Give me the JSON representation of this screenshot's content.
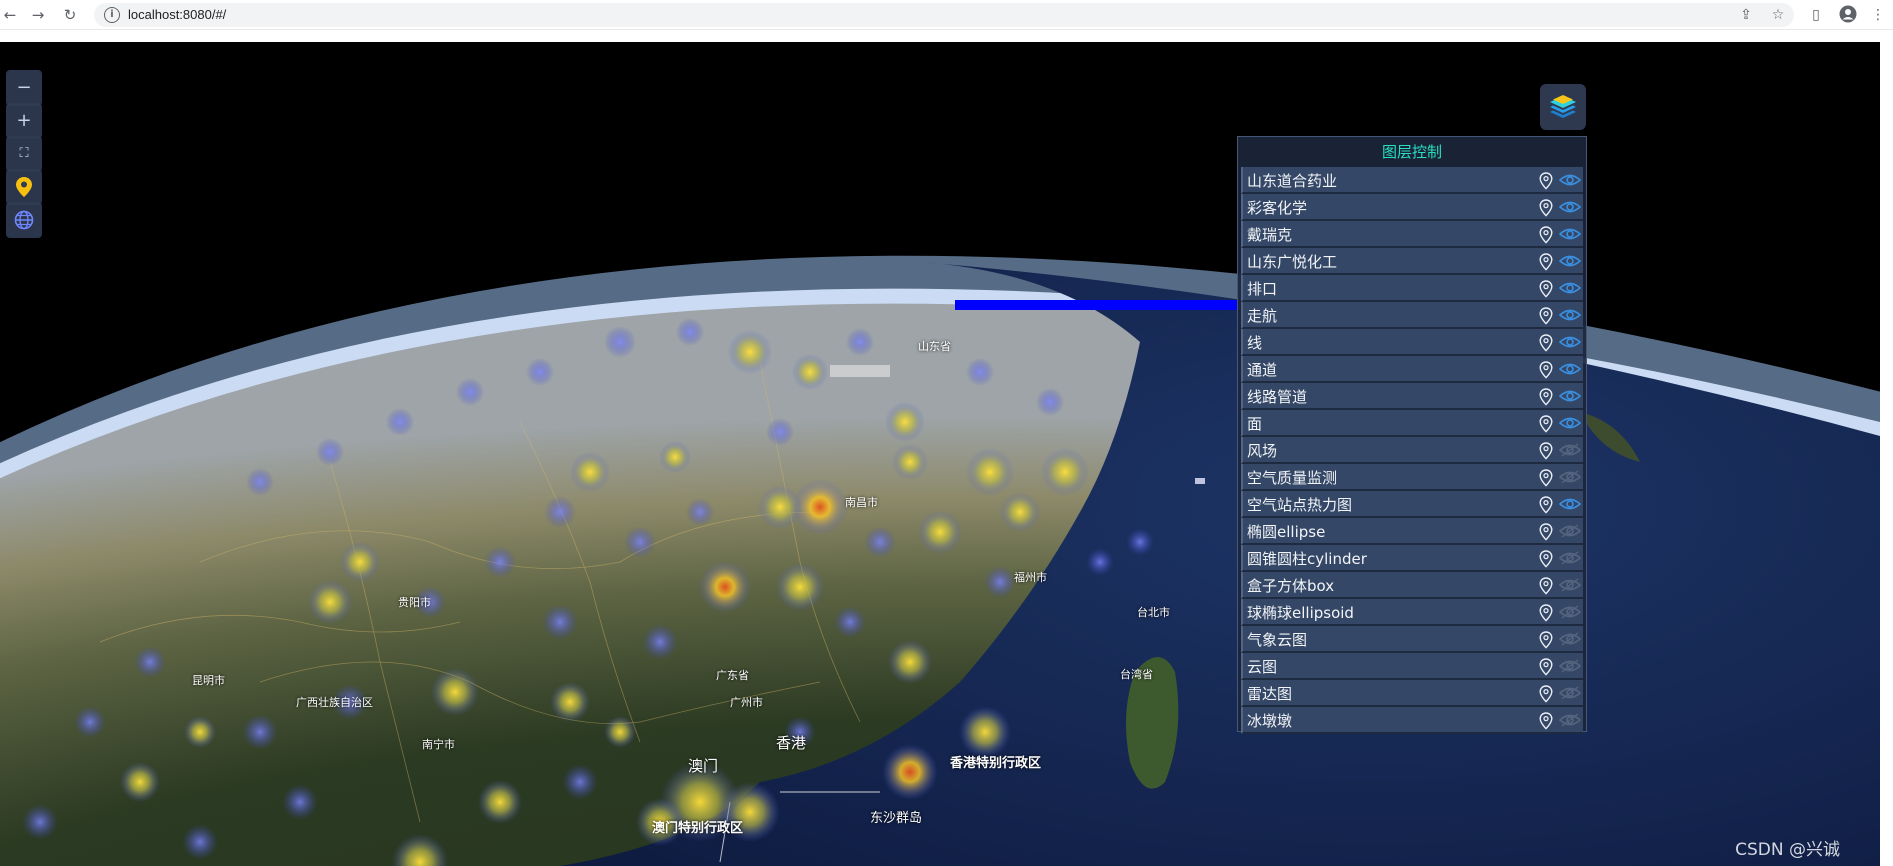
{
  "browser": {
    "url": "localhost:8080/#/",
    "back_icon": "arrow-left-icon",
    "forward_icon": "arrow-right-icon",
    "reload_icon": "reload-icon"
  },
  "toolbar": {
    "zoom_out": "−",
    "zoom_in": "+",
    "fullscreen": "⛶",
    "locate_icon": "map-pin-icon",
    "globe_icon": "globe-icon"
  },
  "layer_panel": {
    "title": "图层控制",
    "items": [
      {
        "label": "山东道合药业",
        "visible": true
      },
      {
        "label": "彩客化学",
        "visible": true
      },
      {
        "label": "戴瑞克",
        "visible": true
      },
      {
        "label": "山东广悦化工",
        "visible": true
      },
      {
        "label": "排口",
        "visible": true
      },
      {
        "label": "走航",
        "visible": true
      },
      {
        "label": "线",
        "visible": true
      },
      {
        "label": "通道",
        "visible": true
      },
      {
        "label": "线路管道",
        "visible": true
      },
      {
        "label": "面",
        "visible": true
      },
      {
        "label": "风场",
        "visible": false
      },
      {
        "label": "空气质量监测",
        "visible": false
      },
      {
        "label": "空气站点热力图",
        "visible": true
      },
      {
        "label": "椭圆ellipse",
        "visible": false
      },
      {
        "label": "圆锥圆柱cylinder",
        "visible": false
      },
      {
        "label": "盒子方体box",
        "visible": false
      },
      {
        "label": "球椭球ellipsoid",
        "visible": false
      },
      {
        "label": "气象云图",
        "visible": false
      },
      {
        "label": "云图",
        "visible": false
      },
      {
        "label": "雷达图",
        "visible": false
      },
      {
        "label": "冰墩墩",
        "visible": false
      }
    ]
  },
  "map_labels": {
    "hk_region": "香港特别行政区",
    "macau_region": "澳门特别行政区",
    "hongkong": "香港",
    "macau": "澳门",
    "dongsha": "东沙群岛",
    "taiwan": "台湾省",
    "taipei": "台北市",
    "guangzhou": "广州市",
    "guangdong": "广东省",
    "guangxi": "广西壮族自治区",
    "nanning": "南宁市",
    "fuzhou": "福州市",
    "shandong": "山东省",
    "kunming": "昆明市",
    "guiyang": "贵阳市",
    "nanchang": "南昌市"
  },
  "watermark": "CSDN @兴诚",
  "colors": {
    "panel_title": "#27e0c4",
    "eye_on": "#3a8fe0",
    "eye_off": "#55657f",
    "path_line": "#0000ff"
  }
}
